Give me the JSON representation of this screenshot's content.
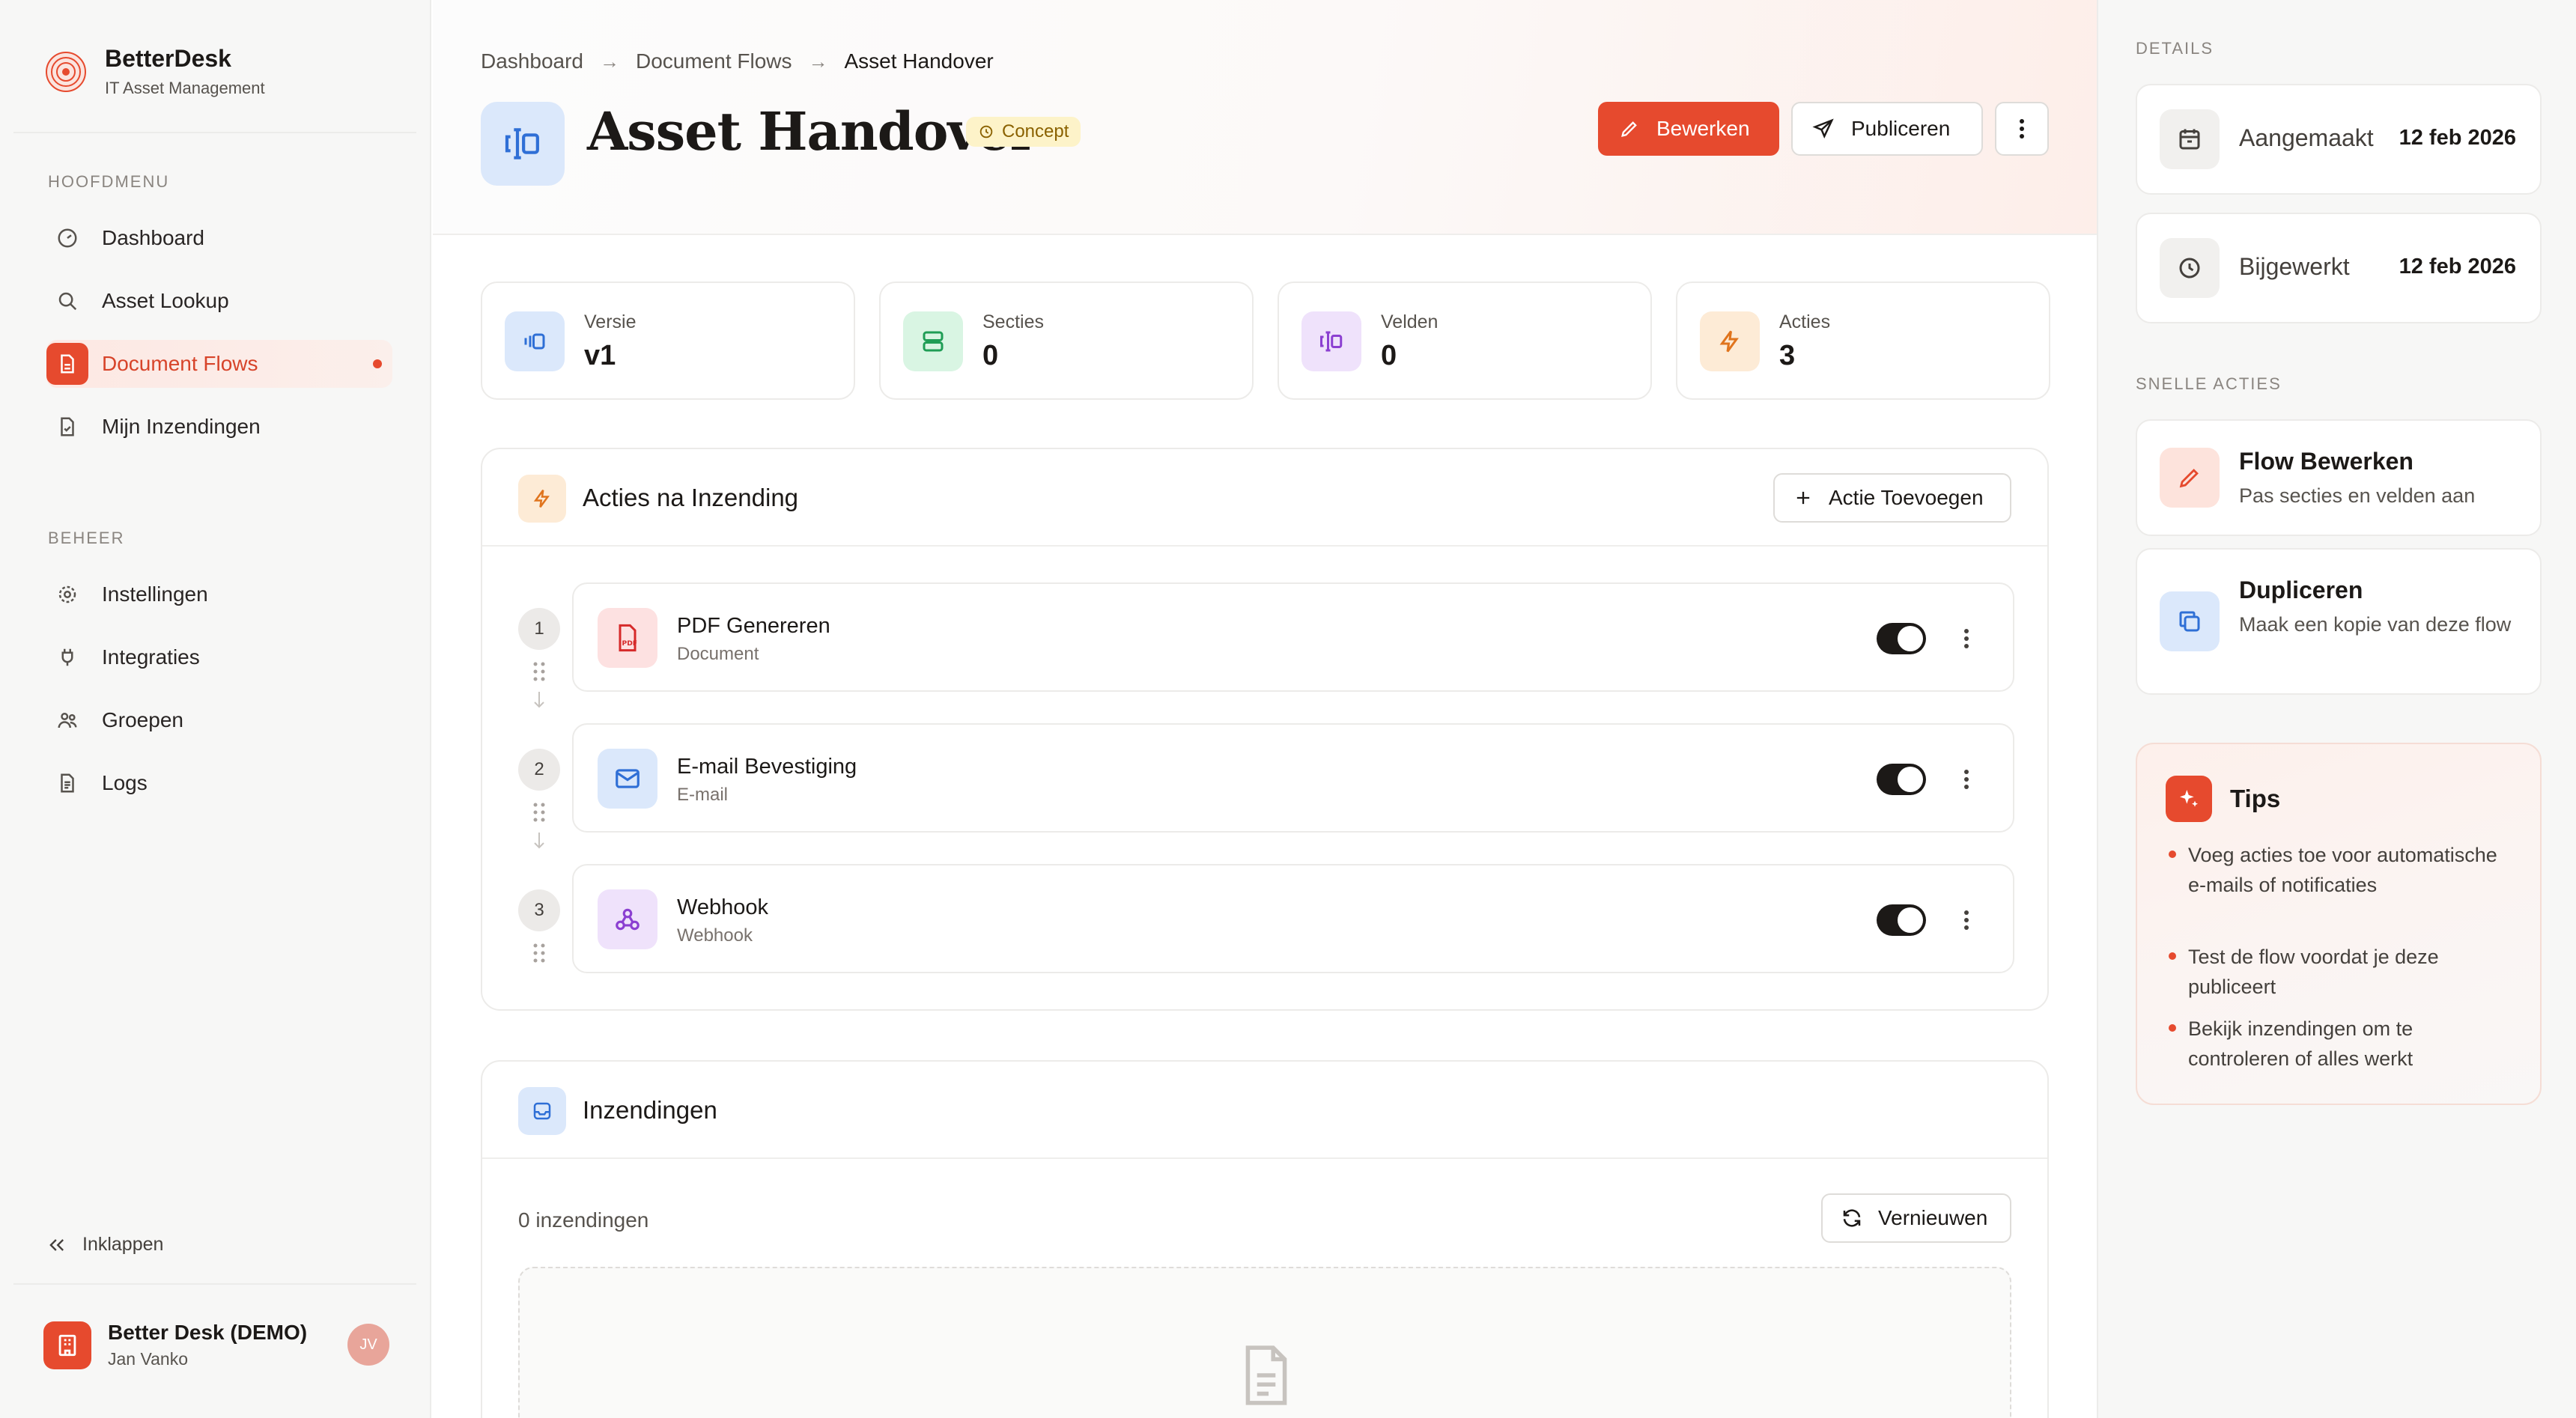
{
  "sidebar": {
    "brand_name": "BetterDesk",
    "brand_sub": "IT Asset Management",
    "section_main": "HOOFDMENU",
    "main_items": [
      {
        "label": "Dashboard",
        "icon": "dashboard-icon"
      },
      {
        "label": "Asset Lookup",
        "icon": "search-icon"
      },
      {
        "label": "Document Flows",
        "icon": "document-icon",
        "active": true
      },
      {
        "label": "Mijn Inzendingen",
        "icon": "file-check-icon"
      }
    ],
    "section_admin": "BEHEER",
    "admin_items": [
      {
        "label": "Instellingen",
        "icon": "gear-icon"
      },
      {
        "label": "Integraties",
        "icon": "plug-icon"
      },
      {
        "label": "Groepen",
        "icon": "users-icon"
      },
      {
        "label": "Logs",
        "icon": "log-icon"
      }
    ],
    "collapse_label": "Inklappen",
    "org_name": "Better Desk (DEMO)",
    "user_name": "Jan Vanko",
    "avatar_initials": "JV"
  },
  "header": {
    "breadcrumb": [
      "Dashboard",
      "Document Flows",
      "Asset Handover"
    ],
    "title": "Asset Handover",
    "status_badge": "Concept",
    "edit_label": "Bewerken",
    "publish_label": "Publiceren"
  },
  "stats": [
    {
      "label": "Versie",
      "value": "v1"
    },
    {
      "label": "Secties",
      "value": "0"
    },
    {
      "label": "Velden",
      "value": "0"
    },
    {
      "label": "Acties",
      "value": "3"
    }
  ],
  "actions_card": {
    "title": "Acties na Inzending",
    "add_label": "Actie Toevoegen",
    "items": [
      {
        "num": "1",
        "title": "PDF Genereren",
        "type": "Document",
        "enabled": true
      },
      {
        "num": "2",
        "title": "E-mail Bevestiging",
        "type": "E-mail",
        "enabled": true
      },
      {
        "num": "3",
        "title": "Webhook",
        "type": "Webhook",
        "enabled": true
      }
    ]
  },
  "submissions_card": {
    "title": "Inzendingen",
    "count_text": "0 inzendingen",
    "refresh_label": "Vernieuwen"
  },
  "right_panel": {
    "details_heading": "DETAILS",
    "created_label": "Aangemaakt",
    "created_value": "12 feb 2026",
    "updated_label": "Bijgewerkt",
    "updated_value": "12 feb 2026",
    "quick_heading": "SNELLE ACTIES",
    "quick_actions": [
      {
        "title": "Flow Bewerken",
        "desc": "Pas secties en velden aan"
      },
      {
        "title": "Dupliceren",
        "desc": "Maak een kopie van deze flow"
      }
    ],
    "tips_title": "Tips",
    "tips": [
      "Voeg acties toe voor automatische e-mails of notificaties",
      "Test de flow voordat je deze publiceert",
      "Bekijk inzendingen om te controleren of alles werkt"
    ]
  },
  "colors": {
    "accent": "#e64a2e",
    "badge_bg": "#fdf3c9",
    "toggle_on": "#1c1917"
  }
}
